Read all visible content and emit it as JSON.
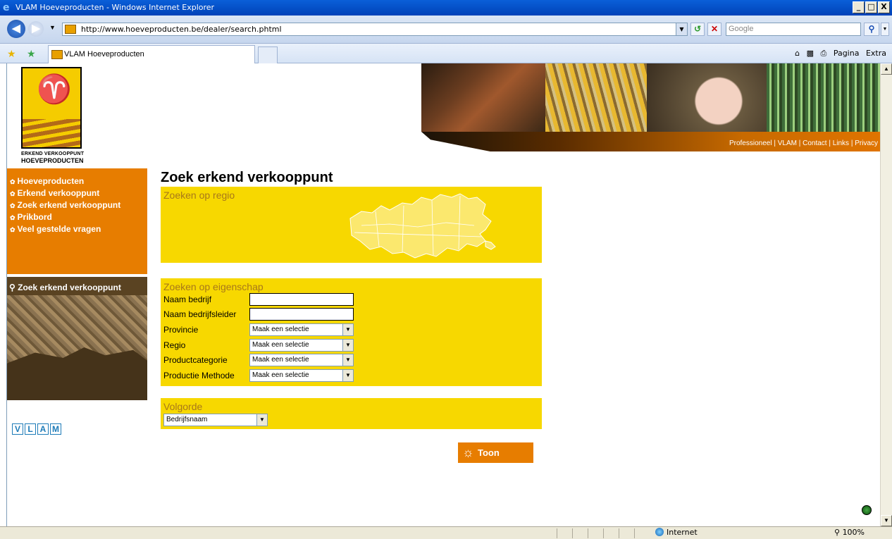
{
  "window": {
    "title": "VLAM Hoeveproducten - Windows Internet Explorer",
    "buttons": [
      "_",
      "□",
      "X"
    ]
  },
  "browser": {
    "url": "http://www.hoeveproducten.be/dealer/search.phtml",
    "search_placeholder": "Google",
    "tab_title": "VLAM Hoeveproducten",
    "commands": {
      "page": "Pagina",
      "extra": "Extra"
    },
    "status": {
      "zone": "Internet",
      "zoom": "100%"
    }
  },
  "site": {
    "logo": {
      "line1": "ERKEND VERKOOPPUNT",
      "line2": "HOEVEPRODUCTEN"
    },
    "topnav": "Professioneel | VLAM | Contact | Links | Privacy",
    "sidenav": [
      "Hoeveproducten",
      "Erkend verkooppunt",
      "Zoek erkend verkooppunt",
      "Prikbord",
      "Veel gestelde vragen"
    ],
    "promo_title": "Zoek erkend verkooppunt",
    "vlam_letters": [
      "V",
      "L",
      "A",
      "M"
    ]
  },
  "main": {
    "title": "Zoek erkend verkooppunt",
    "regio_title": "Zoeken op regio",
    "eigenschap_title": "Zoeken op eigenschap",
    "fields": {
      "naam_bedrijf": "Naam bedrijf",
      "naam_bedrijfsleider": "Naam bedrijfsleider",
      "provincie": "Provincie",
      "regio": "Regio",
      "productcategorie": "Productcategorie",
      "productie_methode": "Productie Methode"
    },
    "select_default": "Maak een selectie",
    "volgorde_title": "Volgorde",
    "volgorde_value": "Bedrijfsnaam",
    "submit_label": "Toon"
  },
  "colors": {
    "orange": "#e77d00",
    "yellow": "#f7d800",
    "panel_title": "#a8781a"
  }
}
